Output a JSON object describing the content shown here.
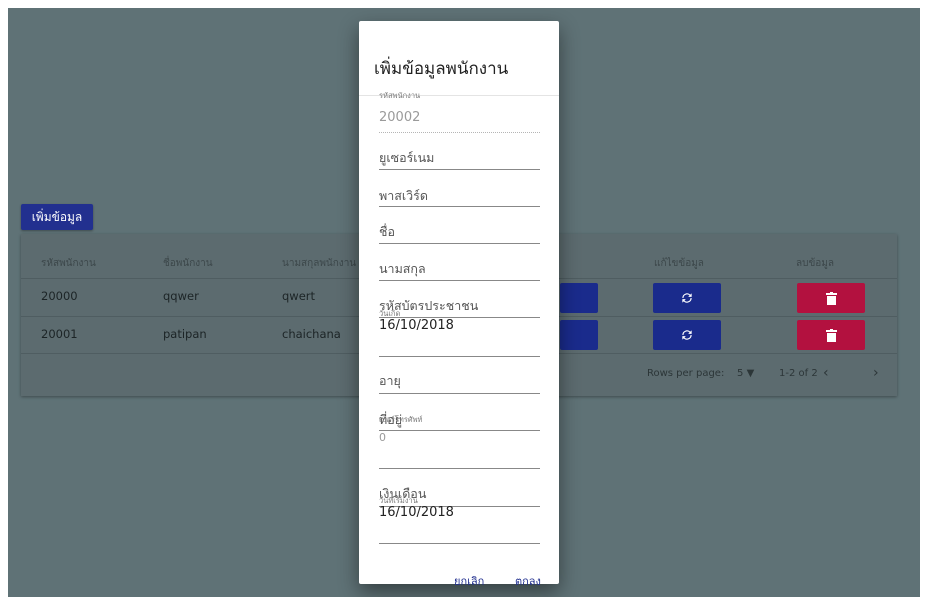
{
  "page": {
    "add_button_label": "เพิ่มข้อมูล"
  },
  "table": {
    "headers": [
      "รหัสพนักงาน",
      "ชื่อพนักงาน",
      "นามสกุลพนักงาน",
      "แก้ไขข้อมูล",
      "ลบข้อมูล"
    ],
    "rows": [
      {
        "id": "20000",
        "name": "qqwer",
        "surname": "qwert"
      },
      {
        "id": "20001",
        "name": "patipan",
        "surname": "chaichana"
      }
    ],
    "footer": {
      "rows_per_page_label": "Rows per page:",
      "rows_per_page_value": "5",
      "range": "1-2 of 2"
    }
  },
  "dialog": {
    "title": "เพิ่มข้อมูลพนักงาน",
    "employee_id_label": "รหัสพนักงาน",
    "employee_id_value": "20002",
    "username_placeholder": "ยูเซอร์เนม",
    "password_placeholder": "พาสเวิร์ด",
    "first_name_placeholder": "ชื่อ",
    "last_name_placeholder": "นามสกุล",
    "national_id_placeholder": "รหัสบัตรประชาชน",
    "birthdate_label": "วันเกิด",
    "birthdate_value": "16/10/2018",
    "age_placeholder": "อายุ",
    "address_placeholder": "ที่อยู่",
    "phone_label": "เบอร์โทรศัพท์",
    "phone_value": "0",
    "salary_placeholder": "เงินเดือน",
    "start_date_label": "วันที่เริ่มงาน",
    "start_date_value": "16/10/2018",
    "cancel_label": "ยกเลิก",
    "ok_label": "ตกลง"
  },
  "colors": {
    "overlay": "#5f7276",
    "primary": "#22308f",
    "danger": "#b3113f"
  },
  "icons": {
    "edit": "refresh-icon",
    "delete": "trash-icon",
    "dropdown": "caret-down-icon",
    "prev": "chevron-left-icon",
    "next": "chevron-right-icon"
  }
}
